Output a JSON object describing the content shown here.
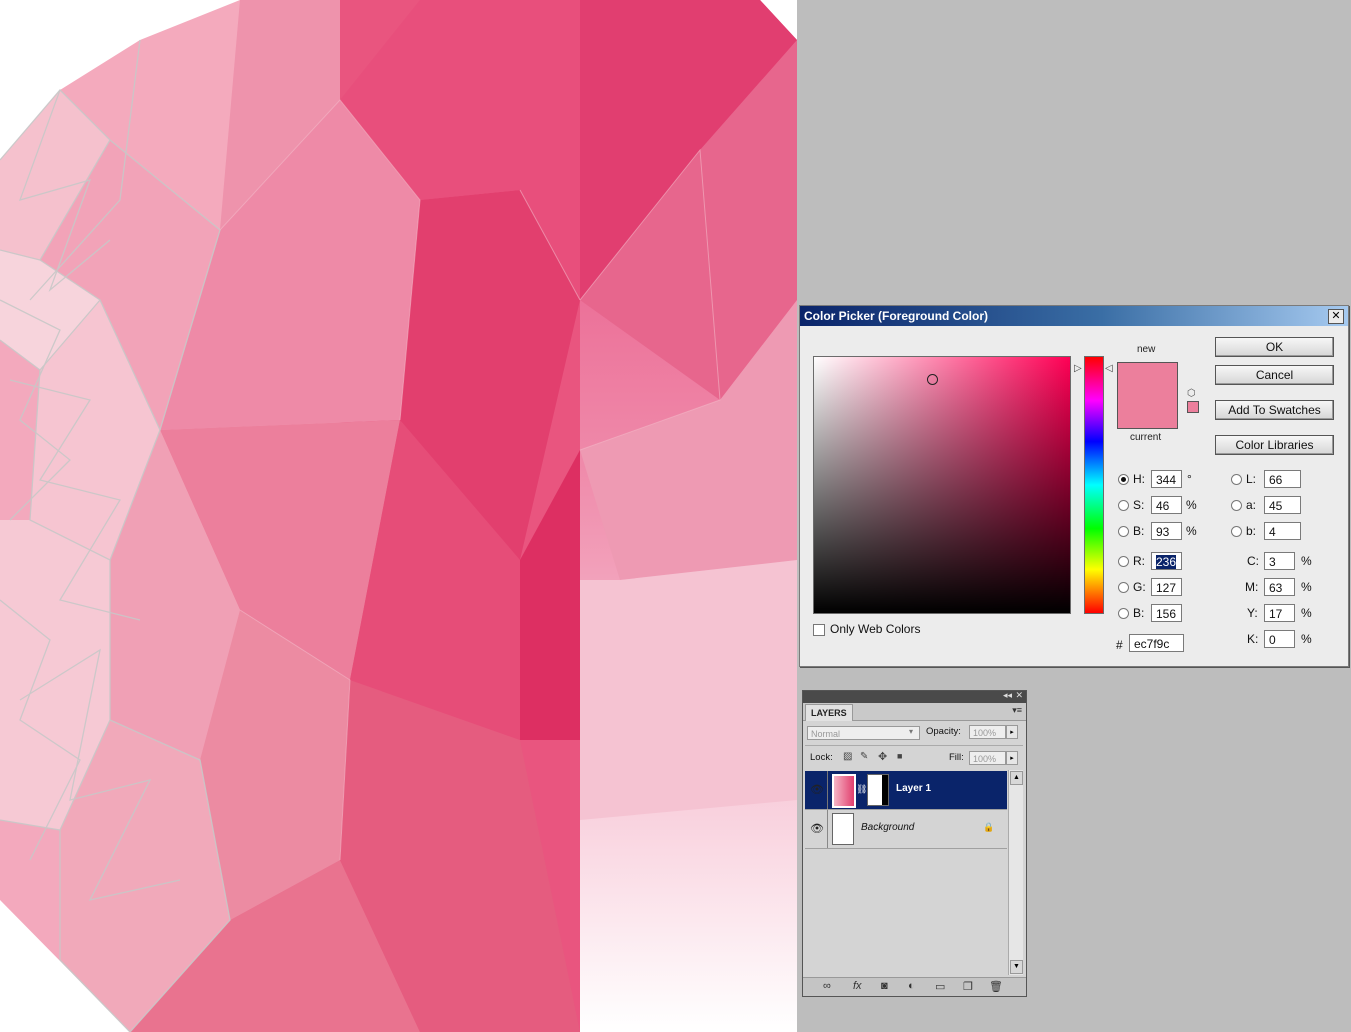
{
  "color_picker": {
    "title": "Color Picker (Foreground Color)",
    "close_glyph": "✕",
    "new_label": "new",
    "current_label": "current",
    "new_color": "#ec7f9c",
    "current_color": "#ec7f9c",
    "hue_color": "#ff0055",
    "buttons": {
      "ok": "OK",
      "cancel": "Cancel",
      "add_to_swatches": "Add To Swatches",
      "color_libraries": "Color Libraries"
    },
    "only_web_colors": "Only Web Colors",
    "hsb": {
      "h_label": "H:",
      "h_value": "344",
      "h_unit": "°",
      "s_label": "S:",
      "s_value": "46",
      "s_unit": "%",
      "b_label": "B:",
      "b_value": "93",
      "b_unit": "%"
    },
    "rgb": {
      "r_label": "R:",
      "r_value": "236",
      "g_label": "G:",
      "g_value": "127",
      "b_label": "B:",
      "b_value": "156"
    },
    "lab": {
      "l_label": "L:",
      "l_value": "66",
      "a_label": "a:",
      "a_value": "45",
      "b_label": "b:",
      "b_value": "4"
    },
    "cmyk": {
      "c_label": "C:",
      "c_value": "3",
      "c_unit": "%",
      "m_label": "M:",
      "m_value": "63",
      "m_unit": "%",
      "y_label": "Y:",
      "y_value": "17",
      "y_unit": "%",
      "k_label": "K:",
      "k_value": "0",
      "k_unit": "%"
    },
    "hex_label": "#",
    "hex_value": "ec7f9c",
    "selected_radio": "H"
  },
  "layers_panel": {
    "tab": "LAYERS",
    "blend_mode": "Normal",
    "opacity_label": "Opacity:",
    "opacity_value": "100%",
    "lock_label": "Lock:",
    "fill_label": "Fill:",
    "fill_value": "100%",
    "layers": [
      {
        "name": "Layer 1",
        "selected": true
      },
      {
        "name": "Background",
        "selected": false
      }
    ]
  }
}
